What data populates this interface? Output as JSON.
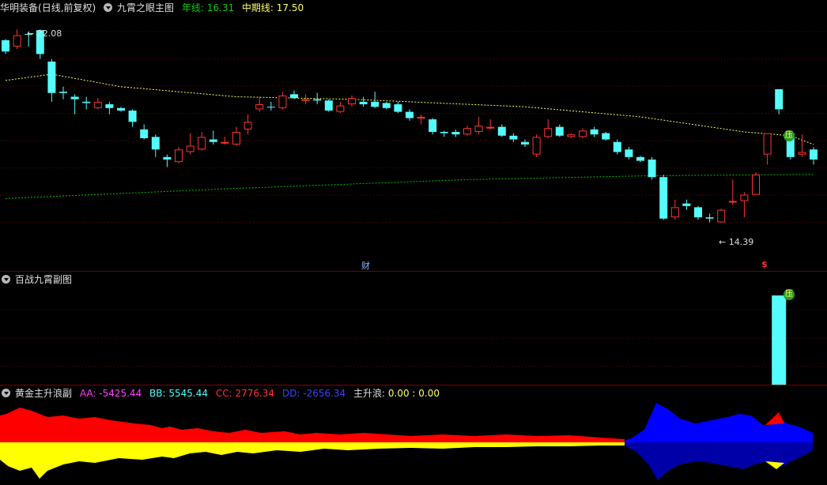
{
  "main_header": {
    "stock_name": "华明装备",
    "adjust_mode": "(日线,前复权)",
    "indicator_name": "九霄之眼主图",
    "year_line_label": "年线: ",
    "year_line_value": "16.31",
    "mid_line_label": "中期线: ",
    "mid_line_value": "17.50"
  },
  "main_annotations": {
    "high_label": "22.08",
    "low_label": "14.39",
    "finance_marker": "财",
    "dollar_marker": "$",
    "pressure_badge": "压"
  },
  "sub1_header": {
    "indicator_name": "百战九霄副图",
    "pressure_badge": "压"
  },
  "sub2_header": {
    "indicator_name": "黄金主升浪副",
    "aa_label": "AA: ",
    "aa_value": "-5425.44",
    "bb_label": "BB: ",
    "bb_value": "5545.44",
    "cc_label": "CC: ",
    "cc_value": "2776.34",
    "dd_label": "DD: ",
    "dd_value": "-2656.34",
    "zsl_label": "主升浪: ",
    "zsl_value": "0.00 : 0.00"
  },
  "colors": {
    "up": "#ff3333",
    "down": "#54fcfc",
    "year_line": "#00c000",
    "mid_line": "#ffff66",
    "aa": "#ff40ff",
    "bb": "#54fcfc",
    "cc": "#ff3333",
    "dd": "#3030ff",
    "zsl": "#ffff66",
    "area_red": "#ff0000",
    "area_yellow": "#ffff00",
    "area_blue": "#0000ff",
    "area_darkblue": "#0000a8"
  },
  "chart_data": {
    "type": "candlestick",
    "price_range": [
      13.0,
      23.0
    ],
    "candles": [
      {
        "o": 21.2,
        "h": 21.7,
        "l": 21.1,
        "c": 21.65,
        "d": "down"
      },
      {
        "o": 21.4,
        "h": 22.08,
        "l": 21.3,
        "c": 21.85,
        "d": "up"
      },
      {
        "o": 21.9,
        "h": 22.0,
        "l": 21.4,
        "c": 21.9,
        "d": "down"
      },
      {
        "o": 22.05,
        "h": 22.08,
        "l": 20.9,
        "c": 21.1,
        "d": "down"
      },
      {
        "o": 20.8,
        "h": 20.9,
        "l": 19.2,
        "c": 19.55,
        "d": "down"
      },
      {
        "o": 19.6,
        "h": 19.8,
        "l": 19.3,
        "c": 19.55,
        "d": "down"
      },
      {
        "o": 19.4,
        "h": 19.5,
        "l": 18.7,
        "c": 19.3,
        "d": "down"
      },
      {
        "o": 19.2,
        "h": 19.4,
        "l": 18.9,
        "c": 19.15,
        "d": "down"
      },
      {
        "o": 18.95,
        "h": 19.35,
        "l": 18.9,
        "c": 19.2,
        "d": "up"
      },
      {
        "o": 19.1,
        "h": 19.2,
        "l": 18.7,
        "c": 18.95,
        "d": "down"
      },
      {
        "o": 18.95,
        "h": 19.0,
        "l": 18.8,
        "c": 18.85,
        "d": "down"
      },
      {
        "o": 18.85,
        "h": 18.9,
        "l": 18.2,
        "c": 18.4,
        "d": "down"
      },
      {
        "o": 18.1,
        "h": 18.3,
        "l": 17.7,
        "c": 17.75,
        "d": "down"
      },
      {
        "o": 17.8,
        "h": 17.9,
        "l": 17.0,
        "c": 17.3,
        "d": "down"
      },
      {
        "o": 17.0,
        "h": 17.1,
        "l": 16.6,
        "c": 16.9,
        "d": "down"
      },
      {
        "o": 16.8,
        "h": 17.4,
        "l": 16.75,
        "c": 17.3,
        "d": "up"
      },
      {
        "o": 17.2,
        "h": 17.95,
        "l": 17.1,
        "c": 17.45,
        "d": "up"
      },
      {
        "o": 17.3,
        "h": 18.0,
        "l": 17.25,
        "c": 17.8,
        "d": "up"
      },
      {
        "o": 17.6,
        "h": 18.05,
        "l": 17.5,
        "c": 17.7,
        "d": "down"
      },
      {
        "o": 17.6,
        "h": 17.8,
        "l": 17.5,
        "c": 17.6,
        "d": "up"
      },
      {
        "o": 17.5,
        "h": 18.2,
        "l": 17.45,
        "c": 18.0,
        "d": "up"
      },
      {
        "o": 18.1,
        "h": 18.7,
        "l": 17.9,
        "c": 18.4,
        "d": "up"
      },
      {
        "o": 18.9,
        "h": 19.4,
        "l": 18.8,
        "c": 19.1,
        "d": "up"
      },
      {
        "o": 19.0,
        "h": 19.2,
        "l": 18.85,
        "c": 19.0,
        "d": "down"
      },
      {
        "o": 18.95,
        "h": 19.6,
        "l": 18.9,
        "c": 19.45,
        "d": "up"
      },
      {
        "o": 19.5,
        "h": 19.65,
        "l": 19.3,
        "c": 19.35,
        "d": "down"
      },
      {
        "o": 19.25,
        "h": 19.5,
        "l": 19.1,
        "c": 19.3,
        "d": "up"
      },
      {
        "o": 19.3,
        "h": 19.55,
        "l": 19.1,
        "c": 19.25,
        "d": "down"
      },
      {
        "o": 19.25,
        "h": 19.3,
        "l": 18.8,
        "c": 18.85,
        "d": "down"
      },
      {
        "o": 18.8,
        "h": 19.2,
        "l": 18.75,
        "c": 19.05,
        "d": "up"
      },
      {
        "o": 19.1,
        "h": 19.45,
        "l": 19.0,
        "c": 19.35,
        "d": "up"
      },
      {
        "o": 19.2,
        "h": 19.4,
        "l": 19.0,
        "c": 19.1,
        "d": "down"
      },
      {
        "o": 19.2,
        "h": 19.6,
        "l": 18.95,
        "c": 19.0,
        "d": "down"
      },
      {
        "o": 19.15,
        "h": 19.2,
        "l": 18.9,
        "c": 18.95,
        "d": "down"
      },
      {
        "o": 19.1,
        "h": 19.2,
        "l": 18.75,
        "c": 18.8,
        "d": "down"
      },
      {
        "o": 18.8,
        "h": 18.9,
        "l": 18.45,
        "c": 18.55,
        "d": "down"
      },
      {
        "o": 18.6,
        "h": 18.7,
        "l": 18.3,
        "c": 18.55,
        "d": "up"
      },
      {
        "o": 18.5,
        "h": 18.55,
        "l": 17.9,
        "c": 18.0,
        "d": "down"
      },
      {
        "o": 18.0,
        "h": 18.05,
        "l": 17.8,
        "c": 17.95,
        "d": "down"
      },
      {
        "o": 17.9,
        "h": 18.1,
        "l": 17.8,
        "c": 18.0,
        "d": "down"
      },
      {
        "o": 17.9,
        "h": 18.25,
        "l": 17.85,
        "c": 18.15,
        "d": "up"
      },
      {
        "o": 18.0,
        "h": 18.6,
        "l": 17.9,
        "c": 18.25,
        "d": "up"
      },
      {
        "o": 18.2,
        "h": 18.5,
        "l": 18.1,
        "c": 18.2,
        "d": "up"
      },
      {
        "o": 18.2,
        "h": 18.3,
        "l": 17.8,
        "c": 17.85,
        "d": "down"
      },
      {
        "o": 17.85,
        "h": 17.95,
        "l": 17.6,
        "c": 17.7,
        "d": "down"
      },
      {
        "o": 17.6,
        "h": 17.7,
        "l": 17.4,
        "c": 17.5,
        "d": "down"
      },
      {
        "o": 17.1,
        "h": 17.9,
        "l": 17.0,
        "c": 17.8,
        "d": "up"
      },
      {
        "o": 17.8,
        "h": 18.5,
        "l": 17.75,
        "c": 18.15,
        "d": "up"
      },
      {
        "o": 18.2,
        "h": 18.3,
        "l": 17.8,
        "c": 17.85,
        "d": "down"
      },
      {
        "o": 17.8,
        "h": 17.95,
        "l": 17.75,
        "c": 17.9,
        "d": "up"
      },
      {
        "o": 17.8,
        "h": 18.15,
        "l": 17.75,
        "c": 18.05,
        "d": "up"
      },
      {
        "o": 18.1,
        "h": 18.2,
        "l": 17.8,
        "c": 17.9,
        "d": "down"
      },
      {
        "o": 17.95,
        "h": 18.0,
        "l": 17.65,
        "c": 17.7,
        "d": "down"
      },
      {
        "o": 17.6,
        "h": 17.7,
        "l": 17.1,
        "c": 17.2,
        "d": "down"
      },
      {
        "o": 17.3,
        "h": 17.4,
        "l": 16.9,
        "c": 17.0,
        "d": "down"
      },
      {
        "o": 17.0,
        "h": 17.05,
        "l": 16.8,
        "c": 16.85,
        "d": "down"
      },
      {
        "o": 16.9,
        "h": 17.0,
        "l": 16.1,
        "c": 16.2,
        "d": "down"
      },
      {
        "o": 16.2,
        "h": 16.3,
        "l": 14.5,
        "c": 14.55,
        "d": "down"
      },
      {
        "o": 14.6,
        "h": 15.3,
        "l": 14.5,
        "c": 15.0,
        "d": "up"
      },
      {
        "o": 15.15,
        "h": 15.3,
        "l": 14.9,
        "c": 15.05,
        "d": "down"
      },
      {
        "o": 15.0,
        "h": 15.05,
        "l": 14.5,
        "c": 14.6,
        "d": "down"
      },
      {
        "o": 14.6,
        "h": 14.75,
        "l": 14.4,
        "c": 14.55,
        "d": "down"
      },
      {
        "o": 14.4,
        "h": 14.95,
        "l": 14.39,
        "c": 14.9,
        "d": "up"
      },
      {
        "o": 15.2,
        "h": 16.1,
        "l": 15.1,
        "c": 15.25,
        "d": "up"
      },
      {
        "o": 15.25,
        "h": 15.6,
        "l": 14.6,
        "c": 15.5,
        "d": "up"
      },
      {
        "o": 15.5,
        "h": 16.4,
        "l": 15.5,
        "c": 16.3,
        "d": "up"
      },
      {
        "o": 17.1,
        "h": 17.8,
        "l": 16.7,
        "c": 17.95,
        "d": "up"
      },
      {
        "o": 19.7,
        "h": 19.7,
        "l": 18.7,
        "c": 18.9,
        "d": "down"
      },
      {
        "o": 17.95,
        "h": 18.0,
        "l": 16.9,
        "c": 17.0,
        "d": "down"
      },
      {
        "o": 17.1,
        "h": 17.9,
        "l": 17.0,
        "c": 17.2,
        "d": "up"
      },
      {
        "o": 17.3,
        "h": 17.4,
        "l": 16.7,
        "c": 16.9,
        "d": "down"
      }
    ],
    "year_line": [
      [
        0,
        15.35
      ],
      [
        20,
        15.75
      ],
      [
        40,
        16.1
      ],
      [
        55,
        16.25
      ],
      [
        70,
        16.31
      ]
    ],
    "mid_line": [
      [
        0,
        20.05
      ],
      [
        4,
        20.3
      ],
      [
        10,
        19.8
      ],
      [
        20,
        19.4
      ],
      [
        30,
        19.3
      ],
      [
        45,
        19.0
      ],
      [
        55,
        18.6
      ],
      [
        64,
        18.0
      ],
      [
        68,
        17.85
      ],
      [
        70,
        17.5
      ]
    ],
    "sub1_bar": {
      "index": 67,
      "value": 1.0
    },
    "sub2_series": {
      "AA": -5425.44,
      "BB": 5545.44,
      "CC": 2776.34,
      "DD": -2656.34
    }
  }
}
